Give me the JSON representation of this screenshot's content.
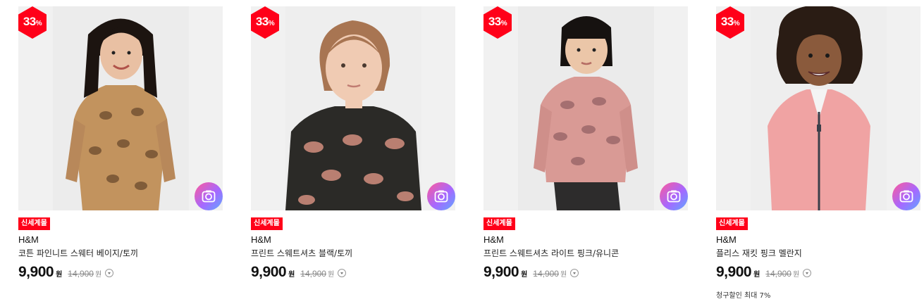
{
  "colors": {
    "badge_red": "#ff0019",
    "tag_red": "#ff0019",
    "image_bg": "#f1f1f1",
    "camera_gradient": [
      "#ff5a9a",
      "#a668ff",
      "#5ea8ff"
    ]
  },
  "products": [
    {
      "discount": "33",
      "discount_unit": "%",
      "tag": "신세계몰",
      "brand": "H&M",
      "name": "코튼 파인니트 스웨터 베이지/토끼",
      "price": "9,900",
      "currency": "원",
      "original_price": "14,900",
      "extra_note": "",
      "icons": [
        "discount-badge",
        "camera-search-icon",
        "info-dropdown-icon"
      ]
    },
    {
      "discount": "33",
      "discount_unit": "%",
      "tag": "신세계몰",
      "brand": "H&M",
      "name": "프린트 스웨트셔츠 블랙/토끼",
      "price": "9,900",
      "currency": "원",
      "original_price": "14,900",
      "extra_note": "",
      "icons": [
        "discount-badge",
        "camera-search-icon",
        "info-dropdown-icon"
      ]
    },
    {
      "discount": "33",
      "discount_unit": "%",
      "tag": "신세계몰",
      "brand": "H&M",
      "name": "프린트 스웨트셔츠 라이트 핑크/유니콘",
      "price": "9,900",
      "currency": "원",
      "original_price": "14,900",
      "extra_note": "",
      "icons": [
        "discount-badge",
        "camera-search-icon",
        "info-dropdown-icon"
      ]
    },
    {
      "discount": "33",
      "discount_unit": "%",
      "tag": "신세계몰",
      "brand": "H&M",
      "name": "플리스 재킷 핑크 멜란지",
      "price": "9,900",
      "currency": "원",
      "original_price": "14,900",
      "extra_note": "청구할인 최대 7%",
      "icons": [
        "discount-badge",
        "camera-search-icon",
        "info-dropdown-icon"
      ]
    }
  ]
}
